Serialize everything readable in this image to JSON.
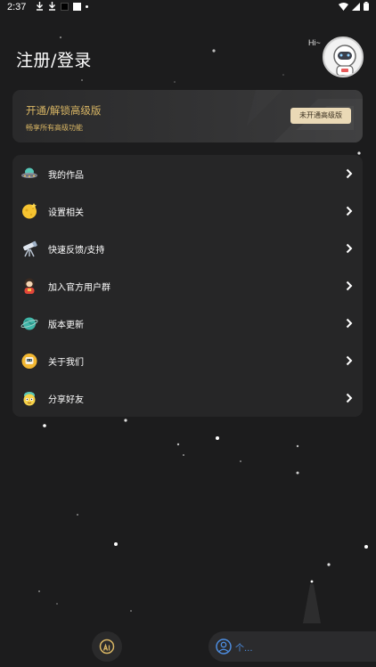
{
  "status_bar": {
    "time": "2:37",
    "icons_left": [
      "download-icon",
      "download-icon",
      "black-square-icon",
      "white-square-icon",
      "dot-icon"
    ],
    "icons_right": [
      "wifi-icon",
      "signal-icon",
      "battery-icon"
    ]
  },
  "header": {
    "title": "注册/登录",
    "greeting": "Hi~",
    "avatar_icon": "astronaut-avatar-icon"
  },
  "vip_card": {
    "title": "开通/解锁高级版",
    "subtitle": "畅享所有高级功能",
    "button_label": "未开通高级版",
    "accent_color": "#d9b664",
    "button_color": "#ead9b6"
  },
  "menu": {
    "items": [
      {
        "label": "我的作品",
        "icon": "ufo-icon"
      },
      {
        "label": "设置相关",
        "icon": "moon-icon"
      },
      {
        "label": "快速反馈/支持",
        "icon": "telescope-icon"
      },
      {
        "label": "加入官方用户群",
        "icon": "astronaut-icon"
      },
      {
        "label": "版本更新",
        "icon": "planet-icon"
      },
      {
        "label": "关于我们",
        "icon": "robot-icon"
      },
      {
        "label": "分享好友",
        "icon": "alien-icon"
      }
    ]
  },
  "bottom_bar": {
    "ai_icon": "ai-icon",
    "user_icon": "user-icon",
    "user_text": "个..."
  },
  "colors": {
    "background": "#1c1c1d",
    "card": "#262627",
    "link_blue": "#4d8de0"
  }
}
